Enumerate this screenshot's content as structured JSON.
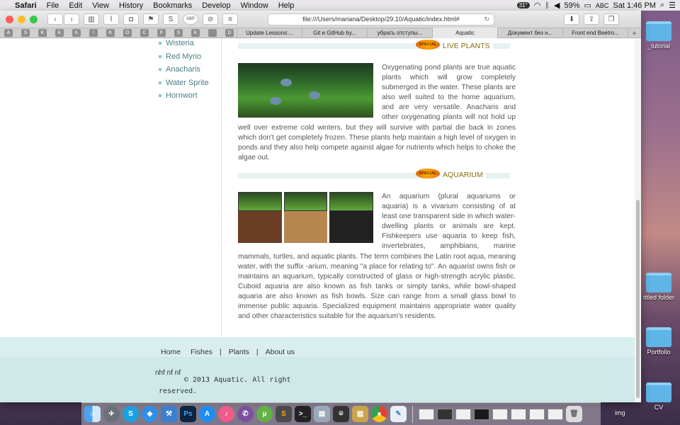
{
  "menubar": {
    "apple": "",
    "app": "Safari",
    "items": [
      "File",
      "Edit",
      "View",
      "History",
      "Bookmarks",
      "Develop",
      "Window",
      "Help"
    ],
    "battery": "59%",
    "input": "ABC",
    "clock": "Sat 1:46 PM",
    "temp": "31°"
  },
  "toolbar": {
    "url": "file:///Users/mariana/Desktop/29.10/Aquatic/index.html#",
    "abp": "ABP",
    "s": "S"
  },
  "favorites": [
    "A",
    "S",
    "K",
    "K",
    "K",
    "!",
    "K",
    "O",
    "C",
    "F",
    "S",
    "K",
    "",
    "D"
  ],
  "tabs": [
    {
      "label": "Update Lessons:...",
      "active": false
    },
    {
      "label": "Git и GitHub by...",
      "active": false
    },
    {
      "label": "убрать отступы...",
      "active": false
    },
    {
      "label": "Aquatic",
      "active": true
    },
    {
      "label": "Документ без н...",
      "active": false
    },
    {
      "label": "Front end Beetro...",
      "active": false
    }
  ],
  "sidebar": {
    "items": [
      "Wisteria",
      "Red Myrio",
      "Anacharis",
      "Water Sprite",
      "Hornwort"
    ]
  },
  "sections": {
    "live_plants": {
      "badge": "SPECIAL",
      "title": "LIVE PLANTS",
      "text": "Oxygenating pond plants are true aquatic plants which will grow completely submerged in the water. These plants are also well suited to the home aquarium, and are very versatile. Anacharis and other oxygenating plants will not hold up well over extreme cold winters, but they will survive with partial die back in zones which don't get completely frozen. These plants help maintain a high level of oxygen in ponds and they also help compete against algae for nutrients which helps to choke the algae out."
    },
    "aquarium": {
      "badge": "SPECIAL",
      "title": "AQUARIUM",
      "text": "An aquarium (plural aquariums or aquaria) is a vivarium consisting of at least one transparent side in which water-dwelling plants or animals are kept. Fishkeepers use aquaria to keep fish, invertebrates, amphibians, marine mammals, turtles, and aquatic plants. The term combines the Latin root aqua, meaning water, with the suffix -arium, meaning \"a place for relating to\". An aquarist owns fish or maintains an aquarium, typically constructed of glass or high-strength acrylic plastic. Cuboid aquaria are also known as fish tanks or simply tanks, while bowl-shaped aquaria are also known as fish bowls. Size can range from a small glass bowl to immense public aquaria. Specialized equipment maintains appropriate water quality and other characteristics suitable for the aquarium's residents."
    }
  },
  "footer": {
    "nav": [
      "Home",
      "Fishes",
      "Plants",
      "About us"
    ],
    "separator": "|",
    "note": "nhf nf nf",
    "copyright": "© 2013 Aquatic. All right",
    "reserved": "reserved."
  },
  "desktop": {
    "icons": [
      "_tutorial",
      "titled folder",
      "Portfolio",
      "CV"
    ]
  },
  "dock": {
    "img_label": "img"
  },
  "colors": {
    "accent_text": "#4a7e86",
    "section_title": "#8a6a0a",
    "footer_bg": "#d9efef"
  }
}
